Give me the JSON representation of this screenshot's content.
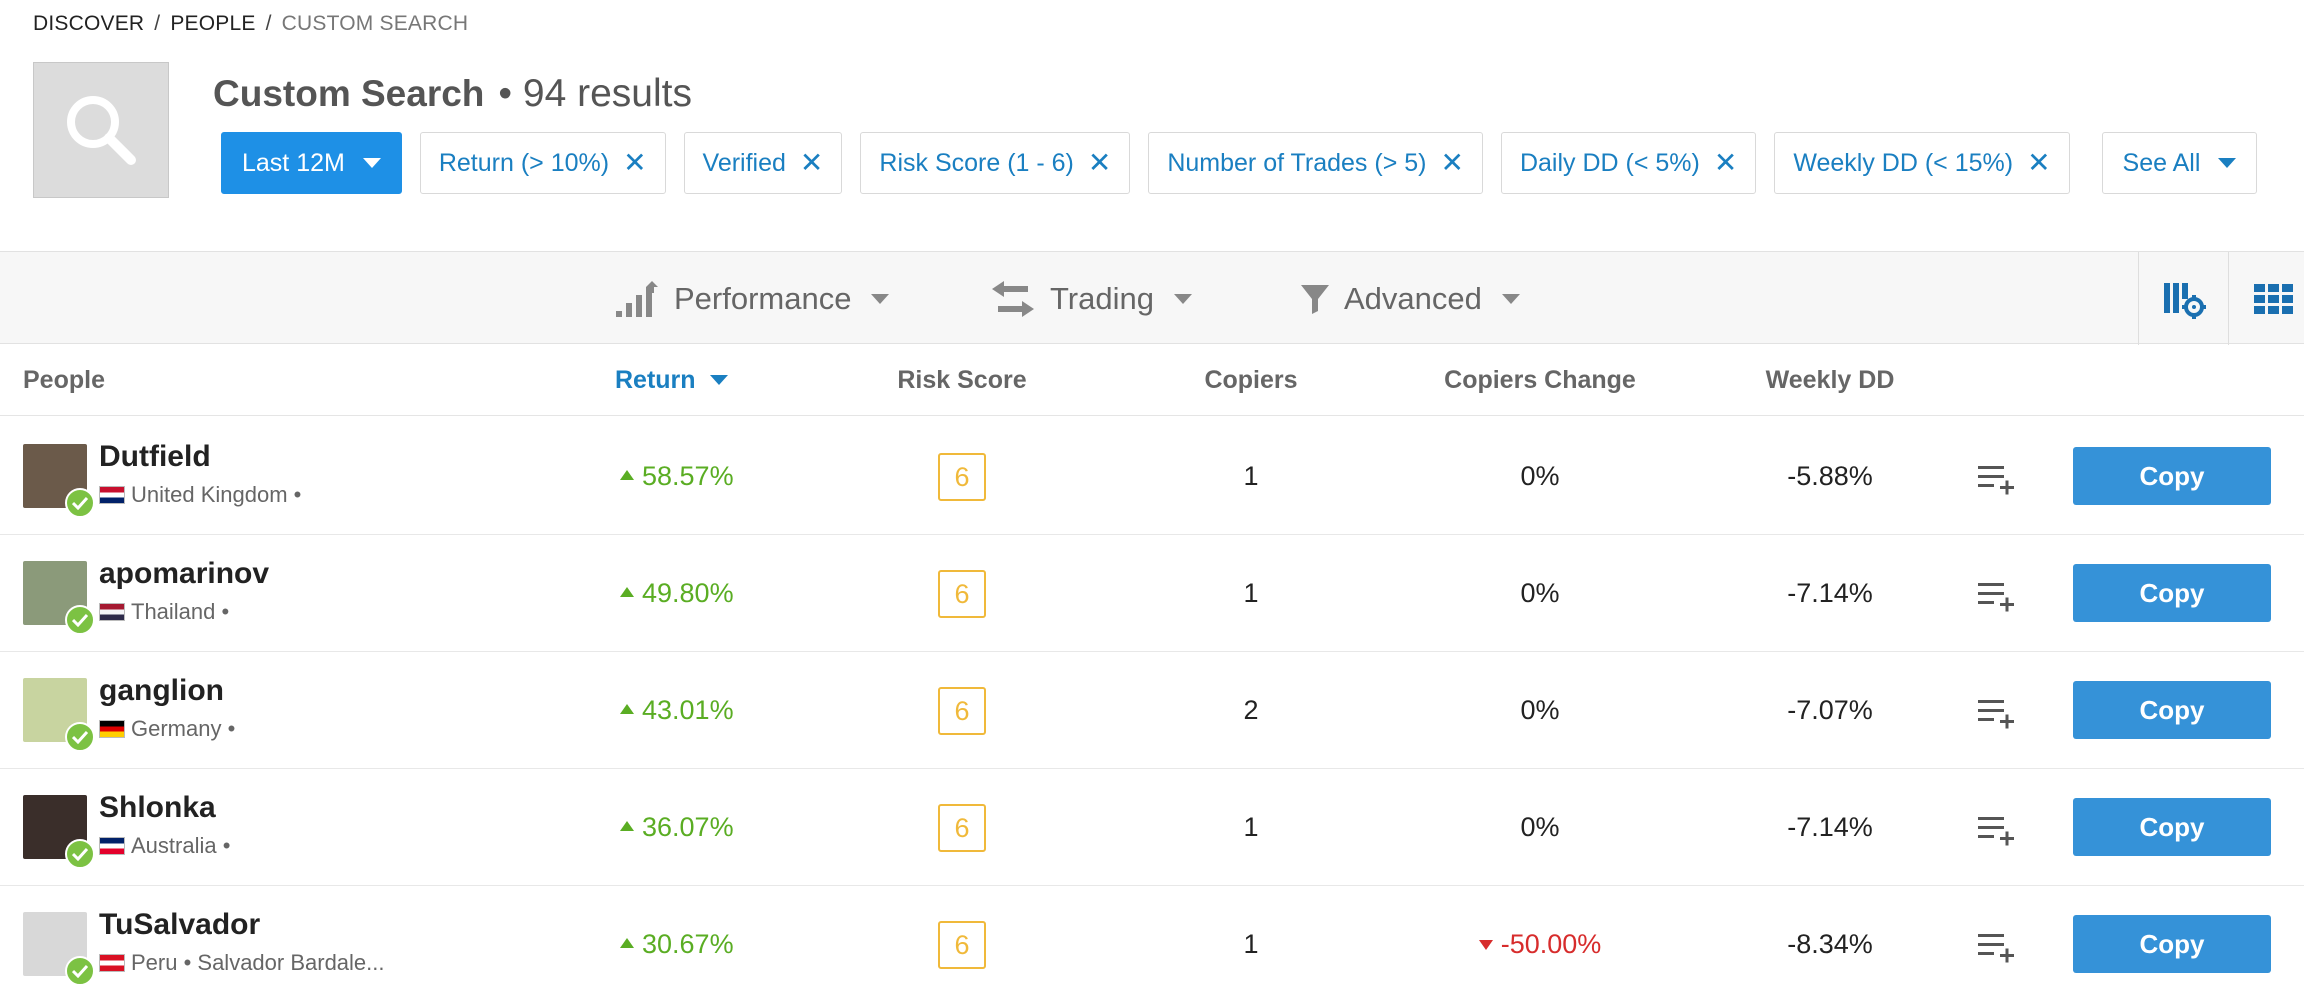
{
  "breadcrumb": {
    "items": [
      "DISCOVER",
      "PEOPLE"
    ],
    "current": "CUSTOM SEARCH",
    "separator": "/"
  },
  "header": {
    "title": "Custom Search",
    "results": "• 94 results"
  },
  "filters": {
    "period": "Last 12M",
    "chips": [
      "Return (> 10%)",
      "Verified",
      "Risk Score (1 - 6)",
      "Number of Trades (> 5)",
      "Daily DD (< 5%)",
      "Weekly DD (< 15%)"
    ],
    "see_all": "See All"
  },
  "toolbar": {
    "performance": "Performance",
    "trading": "Trading",
    "advanced": "Advanced"
  },
  "table": {
    "columns": {
      "people": "People",
      "return": "Return",
      "risk": "Risk Score",
      "copiers": "Copiers",
      "copiers_change": "Copiers Change",
      "weekly_dd": "Weekly DD"
    },
    "rows": [
      {
        "name": "Dutfield",
        "country": "United Kingdom •",
        "return": "58.57%",
        "risk": "6",
        "copiers": "1",
        "change": "0%",
        "change_dir": "flat",
        "weekly_dd": "-5.88%",
        "copy": "Copy"
      },
      {
        "name": "apomarinov",
        "country": "Thailand •",
        "return": "49.80%",
        "risk": "6",
        "copiers": "1",
        "change": "0%",
        "change_dir": "flat",
        "weekly_dd": "-7.14%",
        "copy": "Copy"
      },
      {
        "name": "ganglion",
        "country": "Germany •",
        "return": "43.01%",
        "risk": "6",
        "copiers": "2",
        "change": "0%",
        "change_dir": "flat",
        "weekly_dd": "-7.07%",
        "copy": "Copy"
      },
      {
        "name": "Shlonka",
        "country": "Australia •",
        "return": "36.07%",
        "risk": "6",
        "copiers": "1",
        "change": "0%",
        "change_dir": "flat",
        "weekly_dd": "-7.14%",
        "copy": "Copy"
      },
      {
        "name": "TuSalvador",
        "country": "Peru • Salvador Bardale...",
        "return": "30.67%",
        "risk": "6",
        "copiers": "1",
        "change": "-50.00%",
        "change_dir": "down",
        "weekly_dd": "-8.34%",
        "copy": "Copy"
      }
    ]
  },
  "colors": {
    "accent": "#1e90e6",
    "positive": "#5aad23",
    "negative": "#d72c2c",
    "risk": "#f0b93a",
    "copy_button": "#3592d8",
    "verified": "#7cc243"
  },
  "icons": [
    "search-icon",
    "bar-chart-icon",
    "swap-arrows-icon",
    "filter-funnel-icon",
    "column-settings-icon",
    "grid-view-icon",
    "verified-check-icon",
    "add-to-watchlist-icon"
  ]
}
